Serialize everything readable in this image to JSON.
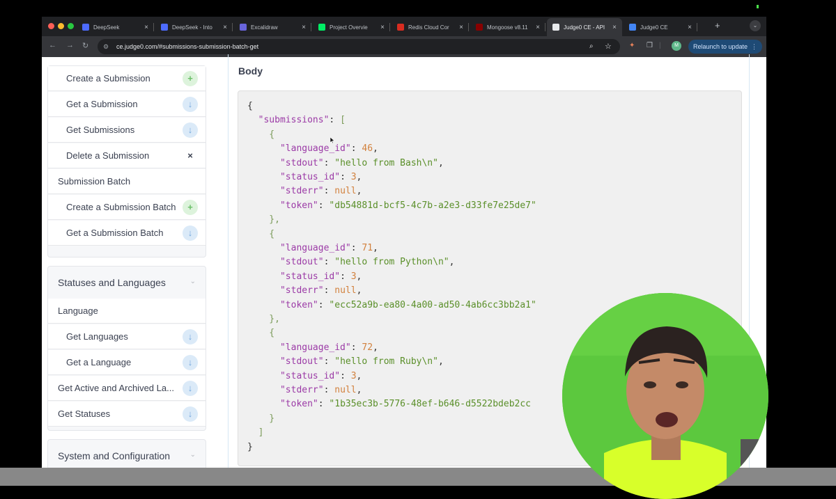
{
  "browser": {
    "tabs": [
      {
        "title": "DeepSeek",
        "color": "#4d6bfe"
      },
      {
        "title": "DeepSeek - Into",
        "color": "#4d6bfe"
      },
      {
        "title": "Excalidraw",
        "color": "#6965db"
      },
      {
        "title": "Project Overvie",
        "color": "#00ed64"
      },
      {
        "title": "Redis Cloud Cor",
        "color": "#d82c20"
      },
      {
        "title": "Mongoose v8.11",
        "color": "#880000"
      },
      {
        "title": "Judge0 CE - API",
        "color": "#e8eaed"
      },
      {
        "title": "Judge0 CE",
        "color": "#4285f4"
      }
    ],
    "close_glyph": "×",
    "new_tab_glyph": "+",
    "tab_menu_glyph": "⌄",
    "address": "ce.judge0.com/#submissions-submission-batch-get",
    "profile_initial": "M",
    "relaunch_label": "Relaunch to update",
    "relaunch_dots": "⋮"
  },
  "sidebar": {
    "submission_items": [
      {
        "label": "Create a Submission",
        "method": "post",
        "icon": "plus-icon",
        "glyph": "+"
      },
      {
        "label": "Get a Submission",
        "method": "get",
        "icon": "arrow-down-icon",
        "glyph": "↓"
      },
      {
        "label": "Get Submissions",
        "method": "get",
        "icon": "arrow-down-icon",
        "glyph": "↓"
      },
      {
        "label": "Delete a Submission",
        "method": "delete",
        "icon": "x-icon",
        "glyph": "×"
      }
    ],
    "batch_heading": "Submission Batch",
    "batch_items": [
      {
        "label": "Create a Submission Batch",
        "method": "post",
        "icon": "plus-icon",
        "glyph": "+"
      },
      {
        "label": "Get a Submission Batch",
        "method": "get",
        "icon": "arrow-down-icon",
        "glyph": "↓"
      }
    ],
    "statuses_group": "Statuses and Languages",
    "language_heading": "Language",
    "language_items": [
      {
        "label": "Get Languages",
        "method": "get",
        "icon": "arrow-down-icon",
        "glyph": "↓"
      },
      {
        "label": "Get a Language",
        "method": "get",
        "icon": "arrow-down-icon",
        "glyph": "↓"
      }
    ],
    "statuses_items": [
      {
        "label": "Get Active and Archived La...",
        "method": "get",
        "icon": "arrow-down-icon",
        "glyph": "↓"
      },
      {
        "label": "Get Statuses",
        "method": "get",
        "icon": "arrow-down-icon",
        "glyph": "↓"
      }
    ],
    "system_group": "System and Configuration",
    "chevron_glyph": "⌄"
  },
  "main": {
    "body_title": "Body",
    "code_lines": [
      [
        {
          "t": "{",
          "c": ""
        }
      ],
      [
        {
          "t": "  ",
          "c": ""
        },
        {
          "t": "\"submissions\"",
          "c": "k"
        },
        {
          "t": ": ",
          "c": ""
        },
        {
          "t": "[",
          "c": "b"
        }
      ],
      [
        {
          "t": "    {",
          "c": "b"
        }
      ],
      [
        {
          "t": "      ",
          "c": ""
        },
        {
          "t": "\"language_id\"",
          "c": "k"
        },
        {
          "t": ": ",
          "c": ""
        },
        {
          "t": "46",
          "c": "n"
        },
        {
          "t": ",",
          "c": ""
        }
      ],
      [
        {
          "t": "      ",
          "c": ""
        },
        {
          "t": "\"stdout\"",
          "c": "k"
        },
        {
          "t": ": ",
          "c": ""
        },
        {
          "t": "\"hello from Bash\\n\"",
          "c": "s"
        },
        {
          "t": ",",
          "c": ""
        }
      ],
      [
        {
          "t": "      ",
          "c": ""
        },
        {
          "t": "\"status_id\"",
          "c": "k"
        },
        {
          "t": ": ",
          "c": ""
        },
        {
          "t": "3",
          "c": "n"
        },
        {
          "t": ",",
          "c": ""
        }
      ],
      [
        {
          "t": "      ",
          "c": ""
        },
        {
          "t": "\"stderr\"",
          "c": "k"
        },
        {
          "t": ": ",
          "c": ""
        },
        {
          "t": "null",
          "c": "n"
        },
        {
          "t": ",",
          "c": ""
        }
      ],
      [
        {
          "t": "      ",
          "c": ""
        },
        {
          "t": "\"token\"",
          "c": "k"
        },
        {
          "t": ": ",
          "c": ""
        },
        {
          "t": "\"db54881d-bcf5-4c7b-a2e3-d33fe7e25de7\"",
          "c": "s"
        }
      ],
      [
        {
          "t": "    },",
          "c": "b"
        }
      ],
      [
        {
          "t": "    {",
          "c": "b"
        }
      ],
      [
        {
          "t": "      ",
          "c": ""
        },
        {
          "t": "\"language_id\"",
          "c": "k"
        },
        {
          "t": ": ",
          "c": ""
        },
        {
          "t": "71",
          "c": "n"
        },
        {
          "t": ",",
          "c": ""
        }
      ],
      [
        {
          "t": "      ",
          "c": ""
        },
        {
          "t": "\"stdout\"",
          "c": "k"
        },
        {
          "t": ": ",
          "c": ""
        },
        {
          "t": "\"hello from Python\\n\"",
          "c": "s"
        },
        {
          "t": ",",
          "c": ""
        }
      ],
      [
        {
          "t": "      ",
          "c": ""
        },
        {
          "t": "\"status_id\"",
          "c": "k"
        },
        {
          "t": ": ",
          "c": ""
        },
        {
          "t": "3",
          "c": "n"
        },
        {
          "t": ",",
          "c": ""
        }
      ],
      [
        {
          "t": "      ",
          "c": ""
        },
        {
          "t": "\"stderr\"",
          "c": "k"
        },
        {
          "t": ": ",
          "c": ""
        },
        {
          "t": "null",
          "c": "n"
        },
        {
          "t": ",",
          "c": ""
        }
      ],
      [
        {
          "t": "      ",
          "c": ""
        },
        {
          "t": "\"token\"",
          "c": "k"
        },
        {
          "t": ": ",
          "c": ""
        },
        {
          "t": "\"ecc52a9b-ea80-4a00-ad50-4ab6cc3bb2a1\"",
          "c": "s"
        }
      ],
      [
        {
          "t": "    },",
          "c": "b"
        }
      ],
      [
        {
          "t": "    {",
          "c": "b"
        }
      ],
      [
        {
          "t": "      ",
          "c": ""
        },
        {
          "t": "\"language_id\"",
          "c": "k"
        },
        {
          "t": ": ",
          "c": ""
        },
        {
          "t": "72",
          "c": "n"
        },
        {
          "t": ",",
          "c": ""
        }
      ],
      [
        {
          "t": "      ",
          "c": ""
        },
        {
          "t": "\"stdout\"",
          "c": "k"
        },
        {
          "t": ": ",
          "c": ""
        },
        {
          "t": "\"hello from Ruby\\n\"",
          "c": "s"
        },
        {
          "t": ",",
          "c": ""
        }
      ],
      [
        {
          "t": "      ",
          "c": ""
        },
        {
          "t": "\"status_id\"",
          "c": "k"
        },
        {
          "t": ": ",
          "c": ""
        },
        {
          "t": "3",
          "c": "n"
        },
        {
          "t": ",",
          "c": ""
        }
      ],
      [
        {
          "t": "      ",
          "c": ""
        },
        {
          "t": "\"stderr\"",
          "c": "k"
        },
        {
          "t": ": ",
          "c": ""
        },
        {
          "t": "null",
          "c": "n"
        },
        {
          "t": ",",
          "c": ""
        }
      ],
      [
        {
          "t": "      ",
          "c": ""
        },
        {
          "t": "\"token\"",
          "c": "k"
        },
        {
          "t": ": ",
          "c": ""
        },
        {
          "t": "\"1b35ec3b-5776-48ef-b646-d5522bdeb2cc",
          "c": "s"
        }
      ],
      [
        {
          "t": "    }",
          "c": "b"
        }
      ],
      [
        {
          "t": "  ]",
          "c": "b"
        }
      ],
      [
        {
          "t": "}",
          "c": ""
        }
      ]
    ]
  },
  "colors": {
    "post": "#6abf67",
    "get": "#74a8dd",
    "delete": "#e06c75",
    "webcam_background": "#5cc83e"
  }
}
